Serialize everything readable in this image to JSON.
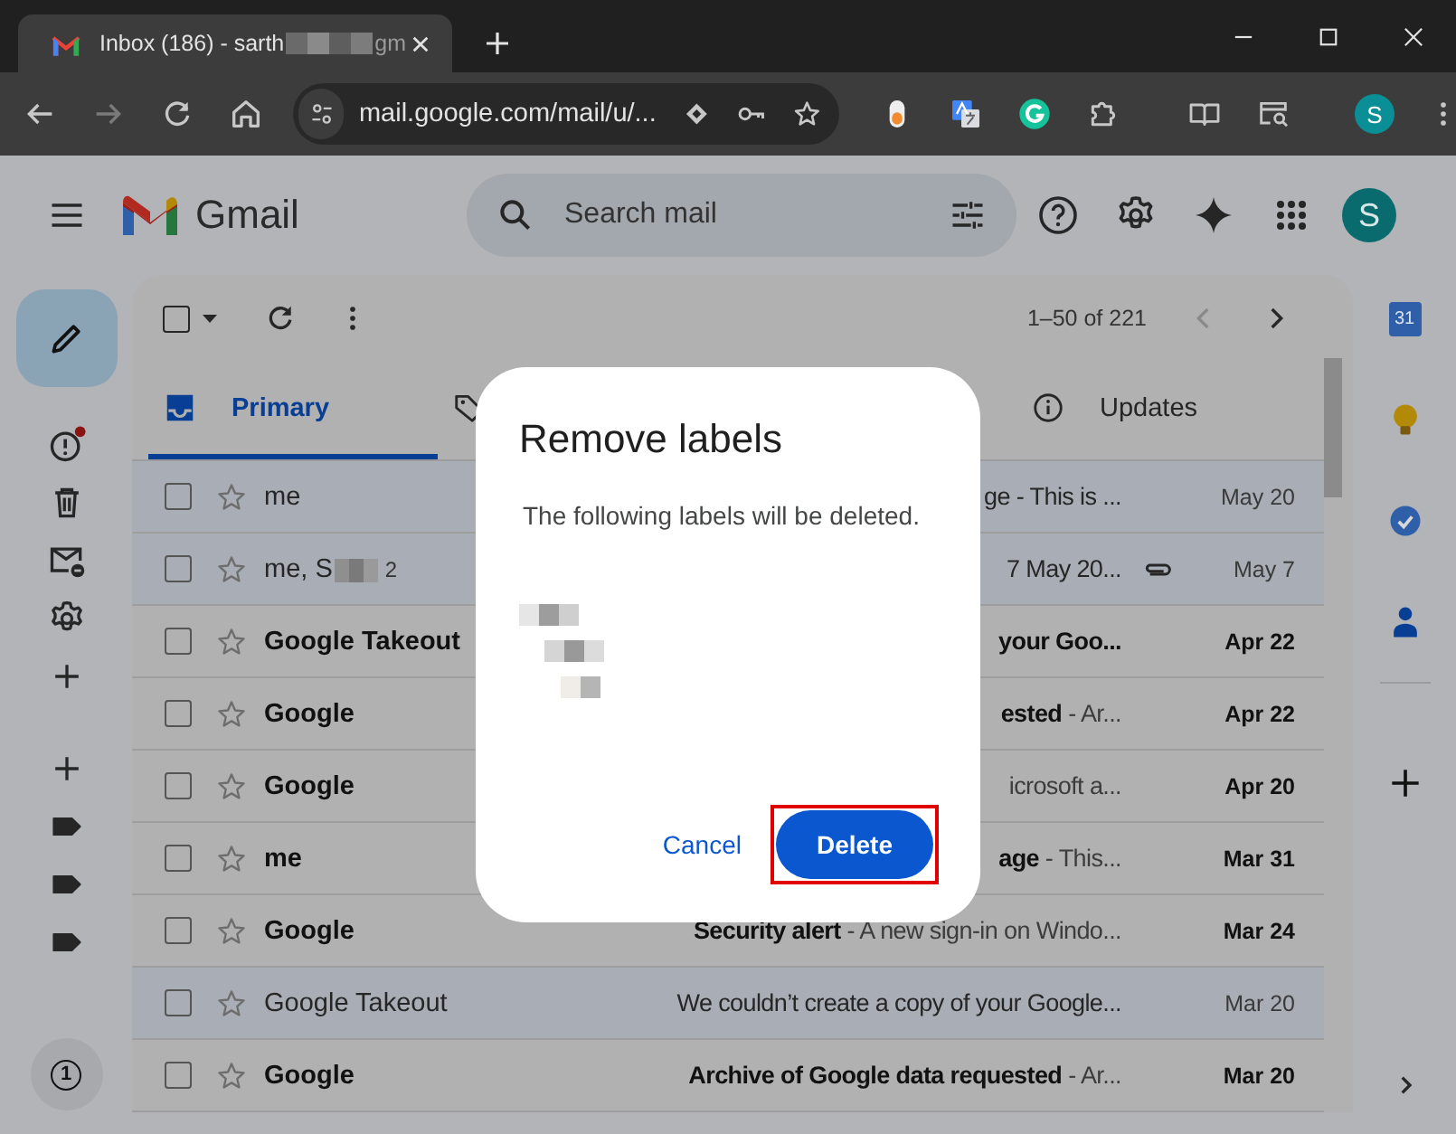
{
  "browser": {
    "tab_title": "Inbox (186) - sarth",
    "tab_title_tail": "gm",
    "url": "mail.google.com/mail/u/...",
    "profile_initial": "S"
  },
  "gmail": {
    "app_name": "Gmail",
    "search": {
      "placeholder": "Search mail"
    },
    "avatar_initial": "S",
    "rail_counter": "1",
    "calendar_day": "31"
  },
  "toolbar": {
    "range": "1–50 of 221",
    "select_all_checked": false
  },
  "tabs": [
    {
      "kind": "inbox",
      "label": "Primary",
      "selected": true
    },
    {
      "kind": "tag",
      "selected": false
    },
    {
      "kind": "info",
      "label": "Updates",
      "selected": false
    }
  ],
  "rows": [
    {
      "sender": "me",
      "sender_redacted": false,
      "subject": "ge - This is ...",
      "attachment": false,
      "date": "May 20",
      "unread": false,
      "checked": false,
      "starred": false
    },
    {
      "sender": "me, S",
      "sender_redacted": true,
      "count": "2",
      "subject": "7 May 20...",
      "attachment": true,
      "date": "May 7",
      "unread": false,
      "checked": false,
      "starred": false
    },
    {
      "sender": "Google Takeout",
      "sender_redacted": false,
      "subject": "**your Goo...**",
      "attachment": false,
      "date": "Apr 22",
      "unread": true,
      "checked": false,
      "starred": false
    },
    {
      "sender": "Google",
      "sender_redacted": false,
      "subject": "**ested** - Ar...",
      "attachment": false,
      "date": "Apr 22",
      "unread": true,
      "checked": false,
      "starred": false
    },
    {
      "sender": "Google",
      "sender_redacted": false,
      "subject": "icrosoft a...",
      "attachment": false,
      "date": "Apr 20",
      "unread": true,
      "checked": false,
      "starred": false
    },
    {
      "sender": "me",
      "sender_redacted": false,
      "subject": "**age** - This...",
      "attachment": false,
      "date": "Mar 31",
      "unread": true,
      "checked": false,
      "starred": false
    },
    {
      "sender": "Google",
      "sender_redacted": false,
      "subject": "**Security alert** - A new sign-in on Windo...",
      "attachment": false,
      "date": "Mar 24",
      "unread": true,
      "checked": false,
      "starred": false
    },
    {
      "sender": "Google Takeout",
      "sender_redacted": false,
      "subject": "We couldn’t create a copy of your Google...",
      "attachment": false,
      "date": "Mar 20",
      "unread": false,
      "checked": false,
      "starred": false
    },
    {
      "sender": "Google",
      "sender_redacted": false,
      "subject": "**Archive of Google data requested** - Ar...",
      "attachment": false,
      "date": "Mar 20",
      "unread": true,
      "checked": false,
      "starred": false
    }
  ],
  "dialog": {
    "title": "Remove labels",
    "message": "The following labels will be deleted.",
    "cancel": "Cancel",
    "confirm": "Delete",
    "confirm_highlighted": true
  }
}
